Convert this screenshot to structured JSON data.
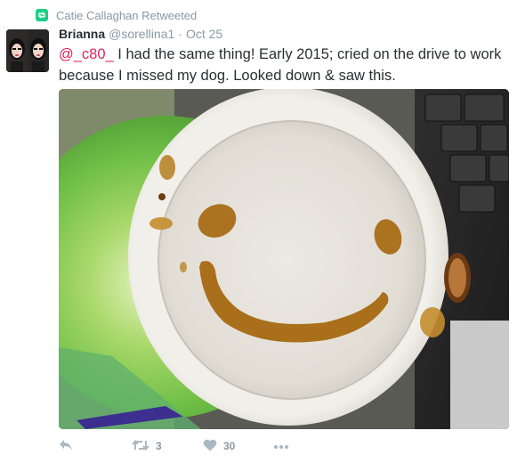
{
  "retweet_context": {
    "icon": "retweet-icon",
    "text": "Catie Callaghan Retweeted",
    "accent": "#19cf86"
  },
  "tweet": {
    "author": {
      "fullname": "Brianna",
      "username": "@sorellina1"
    },
    "separator": "·",
    "timestamp": "Oct 25",
    "text": {
      "mention": "@_c80_",
      "body": " I had the same thing! Early 2015; cried on the drive to work because I missed my dog. Looked down & saw this."
    },
    "mention_color": "#e0245e",
    "media_description": "photo of coffee cup lid with a smiley face made of coffee drips"
  },
  "actions": {
    "reply": {
      "icon": "reply-icon"
    },
    "retweet": {
      "icon": "retweet-icon",
      "count": "3"
    },
    "like": {
      "icon": "heart-icon",
      "count": "30"
    },
    "more": {
      "icon": "more-icon"
    }
  }
}
